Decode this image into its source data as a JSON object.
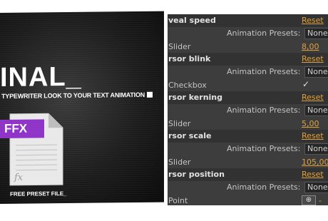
{
  "thumbnail": {
    "title": "INAL_",
    "subtitle": "TYPEWRITER LOOK TO YOUR TEXT ANIMATION",
    "badge": "FFX",
    "fx_glyph": "fx",
    "caption": "FREE PRESET FILE_",
    "badge_color": "#8e32c8"
  },
  "panel": {
    "reset_label": "Reset",
    "presets_label": "Animation Presets:",
    "presets_value": "None",
    "accent_color": "#e0a13c",
    "groups": [
      {
        "name": "veal speed",
        "type": "Slider",
        "value": "8,00"
      },
      {
        "name": "rsor blink",
        "type": "Checkbox",
        "value": "✓"
      },
      {
        "name": "rsor kerning",
        "type": "Slider",
        "value": "5,00"
      },
      {
        "name": "rsor scale",
        "type": "Slider",
        "value": "105,00"
      },
      {
        "name": "rsor position",
        "type": "Point",
        "button_icon": "crosshair-icon",
        "value": "-"
      }
    ]
  }
}
